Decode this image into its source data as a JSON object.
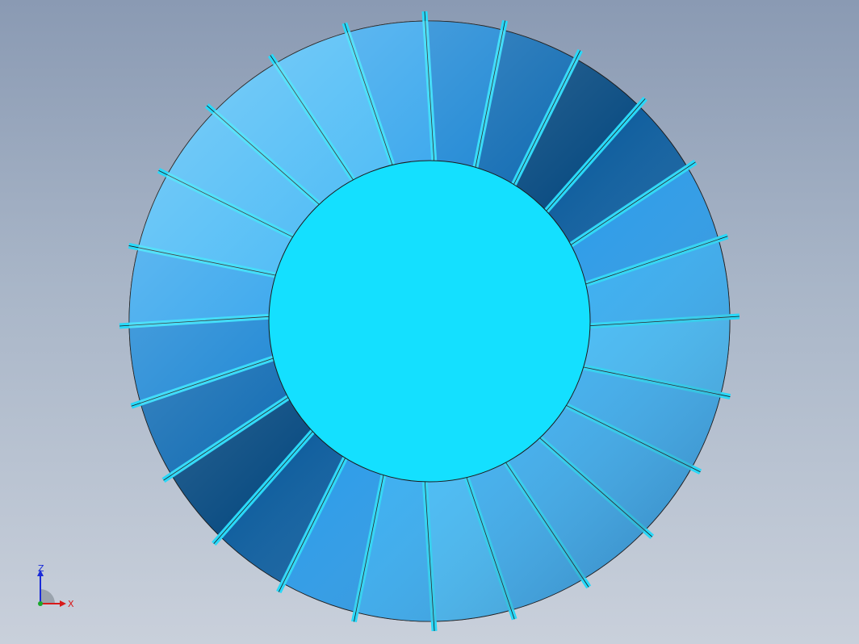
{
  "viewport": {
    "model": "turbine-blade-disk",
    "blade_count": 24,
    "colors": {
      "background_top": "#8a9ab3",
      "background_bottom": "#c9d0db",
      "hub": "#14e0ff",
      "blade_light": "#5ac8ff",
      "blade_mid": "#1e90e0",
      "blade_dark": "#0a4f86",
      "edge": "#1a1a1a"
    }
  },
  "triad": {
    "z_label": "Z",
    "x_label": "X",
    "z_color": "#1a2bd8",
    "x_color": "#d81a1a"
  }
}
